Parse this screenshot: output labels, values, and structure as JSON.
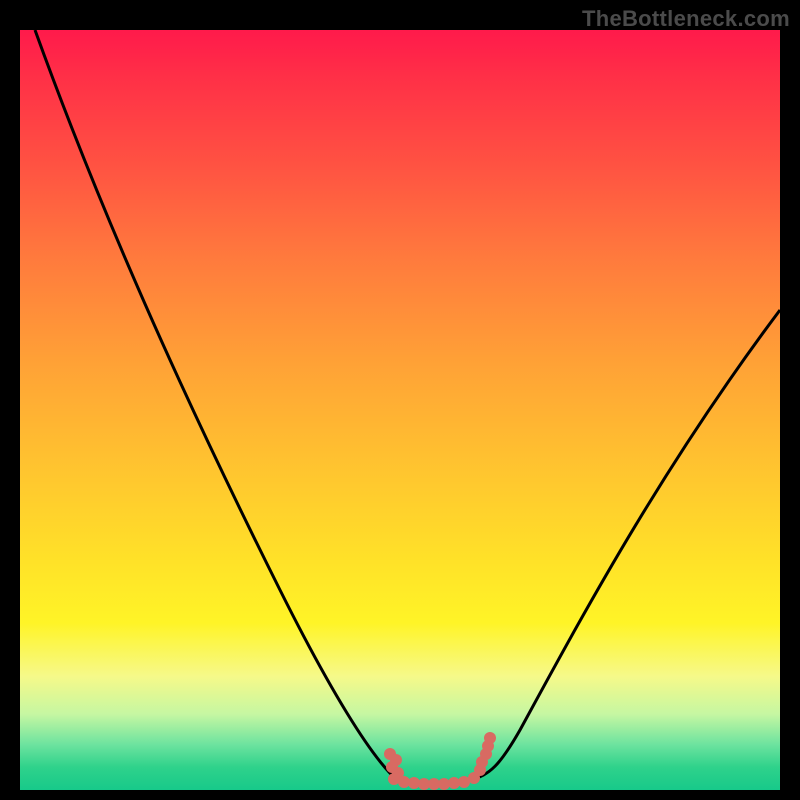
{
  "watermark": "TheBottleneck.com",
  "chart_data": {
    "type": "line",
    "title": "",
    "xlabel": "",
    "ylabel": "",
    "xlim": [
      0,
      100
    ],
    "ylim": [
      0,
      100
    ],
    "series": [
      {
        "name": "curve",
        "x": [
          2,
          10,
          20,
          30,
          38,
          45,
          48,
          50,
          53,
          56,
          60,
          62,
          70,
          80,
          90,
          100
        ],
        "y": [
          100,
          85,
          67,
          48,
          30,
          12,
          4,
          1,
          0.5,
          1,
          4,
          6,
          20,
          36,
          50,
          63
        ]
      }
    ],
    "annotations": {
      "bottom_dotted_band": {
        "x_start": 48,
        "x_end": 62,
        "color": "#d86a62"
      }
    }
  }
}
